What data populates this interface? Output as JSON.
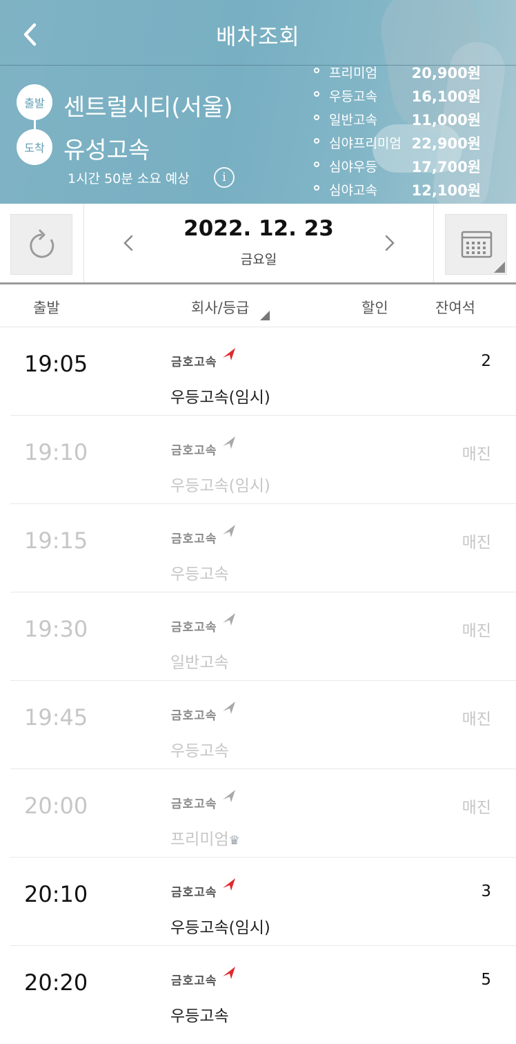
{
  "header": {
    "title": "배차조회",
    "departure_badge": "출발",
    "arrival_badge": "도착",
    "departure": "센트럴시티(서울)",
    "arrival": "유성고속",
    "duration": "1시간 50분 소요 예상",
    "fares": [
      {
        "name": "프리미엄",
        "price": "20,900원"
      },
      {
        "name": "우등고속",
        "price": "16,100원"
      },
      {
        "name": "일반고속",
        "price": "11,000원"
      },
      {
        "name": "심야프리미엄",
        "price": "22,900원"
      },
      {
        "name": "심야우등",
        "price": "17,700원"
      },
      {
        "name": "심야고속",
        "price": "12,100원"
      }
    ]
  },
  "datebar": {
    "date": "2022. 12. 23",
    "day": "금요일"
  },
  "columns": {
    "departure": "출발",
    "company": "회사/등급",
    "discount": "할인",
    "seats": "잔여석"
  },
  "schedule": [
    {
      "time": "19:05",
      "company": "금호고속",
      "grade": "우등고속(임시)",
      "seats": "2",
      "soldout": false
    },
    {
      "time": "19:10",
      "company": "금호고속",
      "grade": "우등고속(임시)",
      "seats": "매진",
      "soldout": true
    },
    {
      "time": "19:15",
      "company": "금호고속",
      "grade": "우등고속",
      "seats": "매진",
      "soldout": true
    },
    {
      "time": "19:30",
      "company": "금호고속",
      "grade": "일반고속",
      "seats": "매진",
      "soldout": true
    },
    {
      "time": "19:45",
      "company": "금호고속",
      "grade": "우등고속",
      "seats": "매진",
      "soldout": true
    },
    {
      "time": "20:00",
      "company": "금호고속",
      "grade": "프리미엄",
      "seats": "매진",
      "soldout": true,
      "crown": true
    },
    {
      "time": "20:10",
      "company": "금호고속",
      "grade": "우등고속(임시)",
      "seats": "3",
      "soldout": false
    },
    {
      "time": "20:20",
      "company": "금호고속",
      "grade": "우등고속",
      "seats": "5",
      "soldout": false
    }
  ],
  "colors": {
    "header_bg": "#7fb3c4",
    "logo_red": "#e0292e",
    "logo_gray": "#a9a9a9",
    "soldout_text": "#c6c6c6"
  },
  "icons": {
    "back": "chevron-left-icon",
    "refresh": "refresh-icon",
    "calendar": "calendar-icon",
    "info": "info-icon",
    "crown": "crown-icon"
  }
}
